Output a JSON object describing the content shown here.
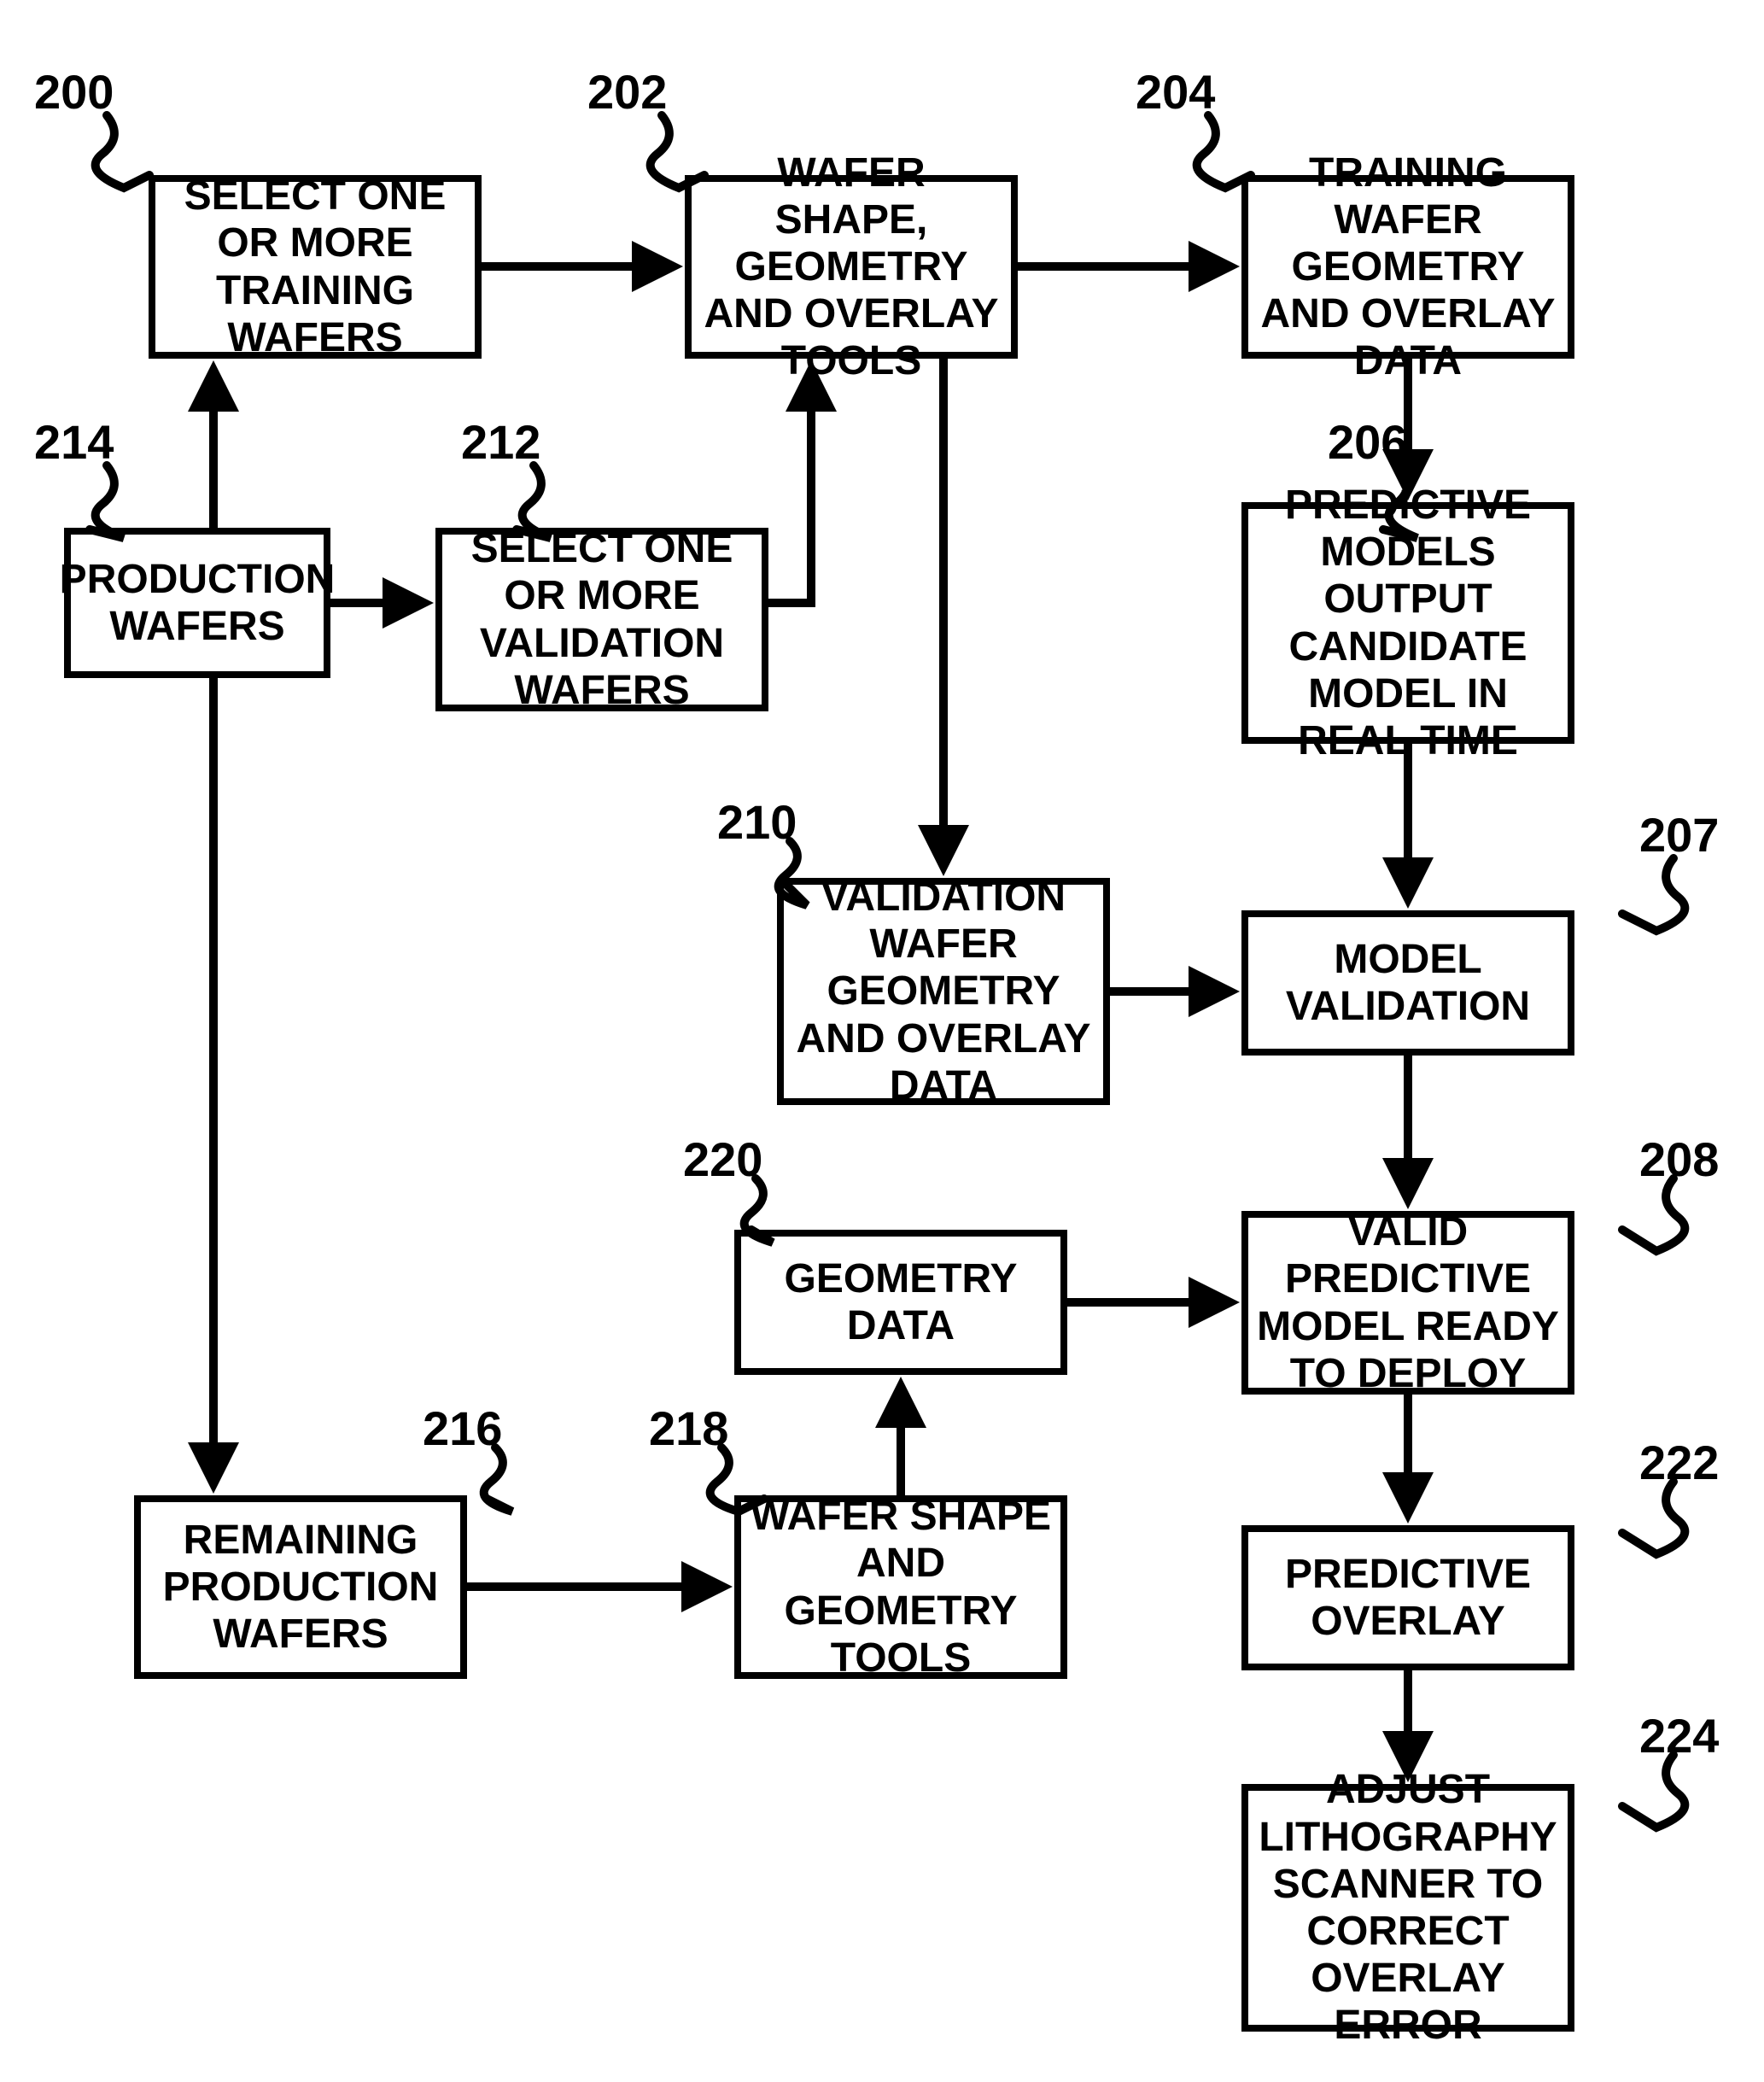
{
  "nodes": {
    "n200": "SELECT ONE OR MORE TRAINING WAFERS",
    "n202": "WAFER SHAPE, GEOMETRY AND OVERLAY TOOLS",
    "n204": "TRAINING WAFER GEOMETRY AND OVERLAY DATA",
    "n206": "PREDICTIVE MODELS OUTPUT CANDIDATE MODEL IN REAL TIME",
    "n207": "MODEL VALIDATION",
    "n208": "VALID PREDICTIVE MODEL READY TO DEPLOY",
    "n210": "VALIDATION WAFER GEOMETRY AND OVERLAY DATA",
    "n212": "SELECT ONE OR MORE VALIDATION WAFERS",
    "n214": "PRODUCTION WAFERS",
    "n216": "REMAINING PRODUCTION WAFERS",
    "n218": "WAFER SHAPE AND GEOMETRY TOOLS",
    "n220": "GEOMETRY DATA",
    "n222": "PREDICTIVE OVERLAY",
    "n224": "ADJUST LITHOGRAPHY SCANNER TO CORRECT OVERLAY ERROR"
  },
  "refs": {
    "r200": "200",
    "r202": "202",
    "r204": "204",
    "r206": "206",
    "r207": "207",
    "r208": "208",
    "r210": "210",
    "r212": "212",
    "r214": "214",
    "r216": "216",
    "r218": "218",
    "r220": "220",
    "r222": "222",
    "r224": "224"
  }
}
